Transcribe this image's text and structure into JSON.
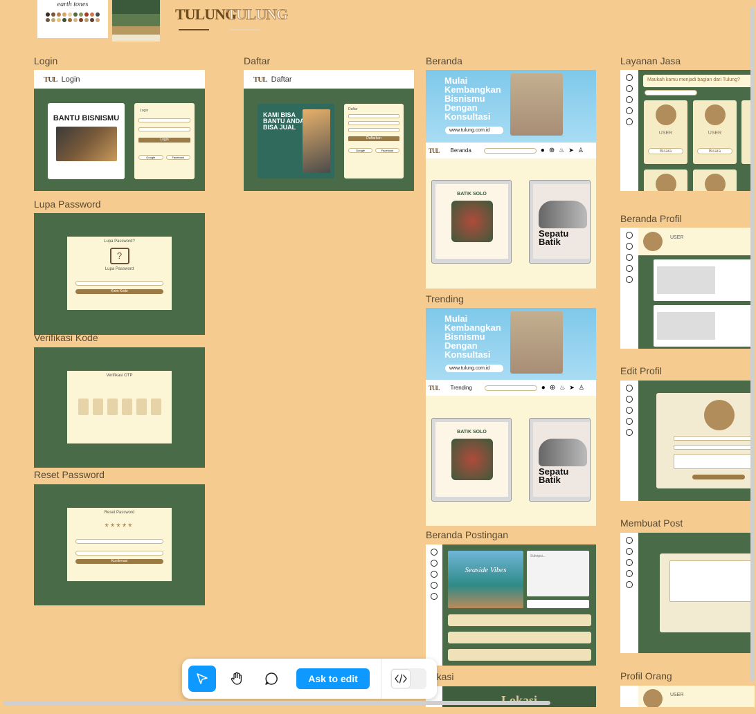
{
  "palette_swatches": {
    "colors": [
      "#3b5a3b",
      "#5e7b4f",
      "#b9995f",
      "#efe6cc"
    ]
  },
  "palette_card": {
    "title": "earth tones"
  },
  "logos": [
    "TULUNG",
    "TULUNG"
  ],
  "frames": {
    "login": {
      "label": "Login",
      "header_title": "Login",
      "promo": "BANTU BISNISMU",
      "card_title": "Login",
      "button": "Login",
      "google": "Google",
      "facebook": "Facebook"
    },
    "daftar": {
      "label": "Daftar",
      "header_title": "Daftar",
      "promo": "KAMI BISA BANTU ANDA BISA JUAL",
      "card_title": "Daftar",
      "button": "Daftarkan",
      "google": "Google",
      "facebook": "Facebook"
    },
    "lupa": {
      "label": "Lupa Password",
      "title": "Lupa Password?",
      "subtitle": "Lupa Password",
      "button": "Kirim Kode"
    },
    "verifikasi": {
      "label": "Verifikasi Kode",
      "title": "Verifikasi OTP"
    },
    "reset": {
      "label": "Reset Password",
      "title": "Reset Password",
      "stars": "*****",
      "button": "Konfirmasi"
    },
    "beranda": {
      "label": "Beranda",
      "hero": "Mulai Kembangkan Bisnismu Dengan Konsultasi",
      "url": "www.tulung.com.id",
      "nav_title": "Beranda",
      "poster1": "BATIK SOLO",
      "poster2": "Sepatu Batik"
    },
    "trending": {
      "label": "Trending",
      "hero": "Mulai Kembangkan Bisnismu Dengan Konsultasi",
      "url": "www.tulung.com.id",
      "nav_title": "Trending",
      "poster1": "BATIK SOLO",
      "poster2": "Sepatu Batik"
    },
    "beranda_postingan": {
      "label": "Beranda Postingan",
      "image_text": "Seaside Vibes",
      "textarea": "Sukripsi..."
    },
    "lokasi": {
      "label": "Lokasi",
      "banner": "Lokasi"
    },
    "layanan": {
      "label": "Layanan Jasa",
      "search": "Maukah kamu menjadi bagian dari Tulung?",
      "user": "USER",
      "btn": "Bicara"
    },
    "beranda_profil": {
      "label": "Beranda Profil",
      "user": "USER"
    },
    "edit_profil": {
      "label": "Edit Profil"
    },
    "membuat_post": {
      "label": "Membuat Post"
    },
    "profil_orang": {
      "label": "Profil Orang",
      "user": "USER"
    }
  },
  "toolbar": {
    "ask_label": "Ask to edit"
  },
  "accent": "#0d99ff"
}
